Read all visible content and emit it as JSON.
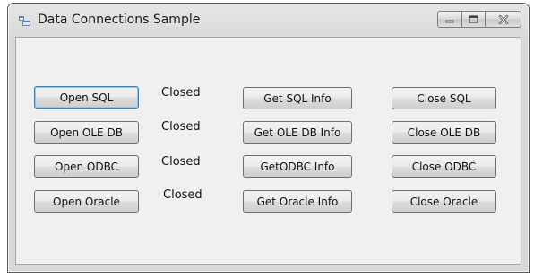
{
  "window": {
    "title": "Data Connections Sample"
  },
  "rows": [
    {
      "open_label": "Open SQL",
      "status": "Closed",
      "info_label": "Get SQL Info",
      "close_label": "Close SQL"
    },
    {
      "open_label": "Open OLE DB",
      "status": "Closed",
      "info_label": "Get OLE DB Info",
      "close_label": "Close OLE DB"
    },
    {
      "open_label": "Open ODBC",
      "status": "Closed",
      "info_label": "GetODBC Info",
      "close_label": "Close ODBC"
    },
    {
      "open_label": "Open Oracle",
      "status": "Closed",
      "info_label": "Get Oracle Info",
      "close_label": "Close Oracle"
    }
  ]
}
